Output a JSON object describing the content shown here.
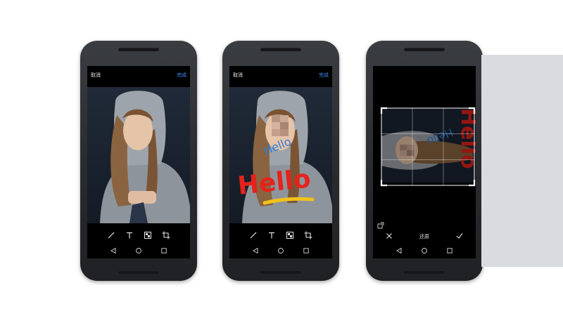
{
  "phones": [
    {
      "topbar": {
        "cancel": "取消",
        "done": "完成"
      }
    },
    {
      "topbar": {
        "cancel": "取消",
        "done": "完成"
      },
      "annotations": {
        "blue_text": "Hello",
        "red_text": "Hello"
      }
    },
    {
      "annotations": {
        "blue_text": "Hello",
        "red_text": "Hello"
      },
      "crop": {
        "revert": "还原"
      }
    }
  ],
  "colors": {
    "accent": "#3f8ef5",
    "annotation_red": "#e5221b",
    "annotation_blue": "#2a7de1",
    "annotation_yellow": "#f2c21b"
  },
  "icons": {
    "tools": [
      "pen-icon",
      "text-icon",
      "mosaic-icon",
      "crop-icon"
    ],
    "nav": [
      "back-icon",
      "home-icon",
      "recents-icon"
    ],
    "crop": [
      "rotate-icon",
      "close-icon",
      "check-icon"
    ]
  }
}
